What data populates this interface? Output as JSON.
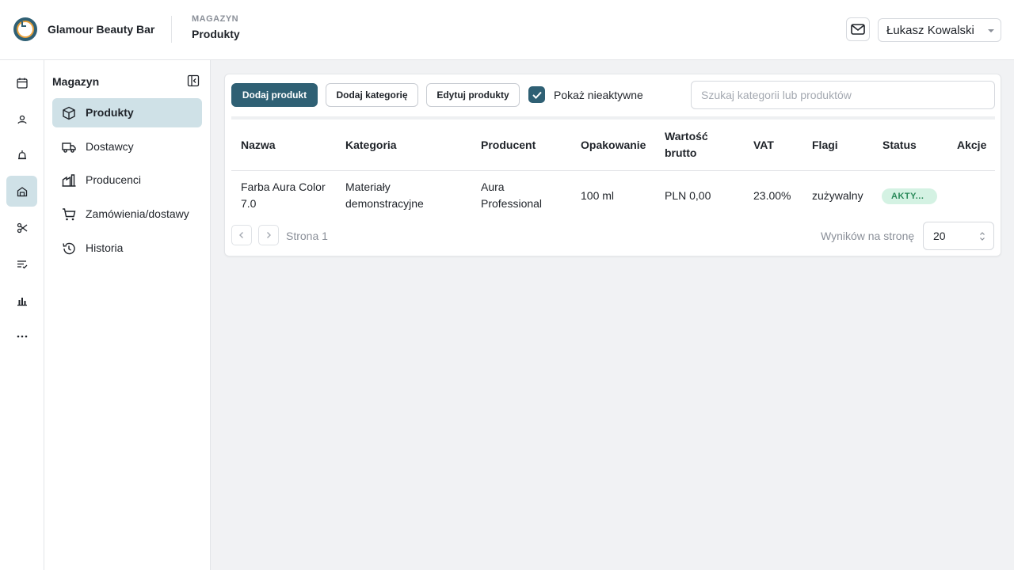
{
  "header": {
    "brand": "Glamour Beauty Bar",
    "section": "MAGAZYN",
    "title": "Produkty",
    "user": "Łukasz Kowalski"
  },
  "rail": {
    "icons": [
      "calendar-icon",
      "clients-icon",
      "notifications-icon",
      "warehouse-icon",
      "services-icon",
      "tasks-icon",
      "reports-icon",
      "more-icon"
    ],
    "active": "warehouse-icon"
  },
  "subnav": {
    "title": "Magazyn",
    "items": [
      {
        "label": "Produkty",
        "icon": "box-icon",
        "active": true
      },
      {
        "label": "Dostawcy",
        "icon": "truck-icon",
        "active": false
      },
      {
        "label": "Producenci",
        "icon": "factory-icon",
        "active": false
      },
      {
        "label": "Zamówienia/dostawy",
        "icon": "cart-icon",
        "active": false
      },
      {
        "label": "Historia",
        "icon": "history-icon",
        "active": false
      }
    ]
  },
  "toolbar": {
    "add_product": "Dodaj produkt",
    "add_category": "Dodaj kategorię",
    "edit_products": "Edytuj produkty",
    "show_inactive": "Pokaż nieaktywne",
    "show_inactive_checked": true,
    "search_placeholder": "Szukaj kategorii lub produktów"
  },
  "table": {
    "headers": {
      "name": "Nazwa",
      "category": "Kategoria",
      "producer": "Producent",
      "packaging": "Opakowanie",
      "gross_value_1": "Wartość",
      "gross_value_2": "brutto",
      "vat": "VAT",
      "flags": "Flagi",
      "status": "Status",
      "actions": "Akcje"
    },
    "rows": [
      {
        "name_1": "Farba Aura Color",
        "name_2": "7.0",
        "category_1": "Materiały",
        "category_2": "demonstracyjne",
        "producer_1": "Aura",
        "producer_2": "Professional",
        "packaging": "100 ml",
        "gross_value": "PLN 0,00",
        "vat": "23.00%",
        "flags": "zużywalny",
        "status": "AKTY..."
      }
    ]
  },
  "pagination": {
    "page": "Strona 1",
    "per_page_label": "Wyników na stronę",
    "per_page": "20"
  },
  "colors": {
    "primary": "#2f6074",
    "active_bg": "#cfe1e7",
    "status_bg": "#d4f2e3",
    "status_text": "#2a8a5a"
  }
}
